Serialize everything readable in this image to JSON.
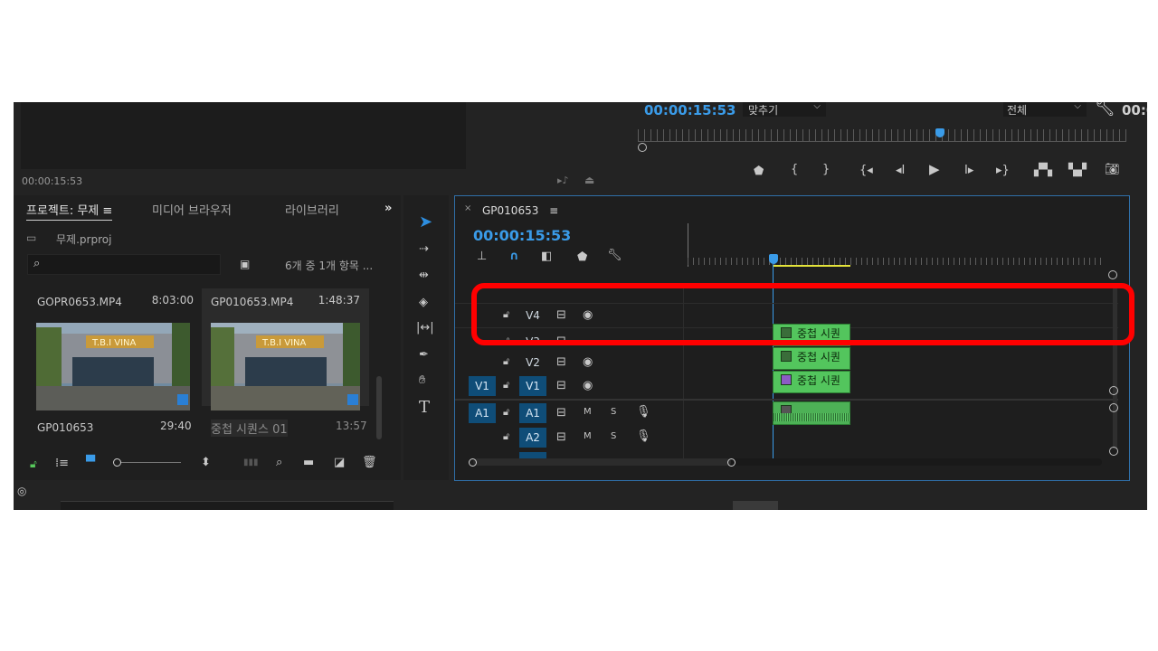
{
  "source_monitor": {
    "timecode": "00:00:15:53"
  },
  "program_monitor": {
    "timecode": "00:00:15:53",
    "fit_label": "맞추기",
    "quality_label": "전체",
    "right_timecode": "00:0"
  },
  "project_panel": {
    "tabs": [
      "프로젝트: 무제",
      "미디어 브라우저",
      "라이브러리"
    ],
    "project_file": "무제.prproj",
    "search_placeholder": "",
    "item_count": "6개 중 1개 항목 ...",
    "items": [
      {
        "name": "GOPR0653.MP4",
        "duration": "8:03:00"
      },
      {
        "name": "GP010653.MP4",
        "duration": "1:48:37"
      },
      {
        "name": "GP010653",
        "duration": "29:40"
      },
      {
        "name": "중첩 시퀀스 01",
        "duration": "13:57"
      }
    ],
    "thumb_sign": "T.B.I VINA"
  },
  "timeline": {
    "sequence_name": "GP010653",
    "timecode": "00:00:15:53",
    "tracks": [
      {
        "source": "",
        "name": "V4"
      },
      {
        "source": "",
        "name": "V3"
      },
      {
        "source": "",
        "name": "V2"
      },
      {
        "source": "V1",
        "name": "V1"
      },
      {
        "source": "A1",
        "name": "A1",
        "m": "M",
        "s": "S"
      },
      {
        "source": "",
        "name": "A2",
        "m": "M",
        "s": "S"
      }
    ],
    "clip_label": "중첩 시퀀"
  },
  "annotation": {
    "color": "#ff0000"
  },
  "colors": {
    "accent": "#3a9be8",
    "clip": "#53c55d",
    "panel": "#1e1e1e",
    "track_on": "#0f4d78"
  }
}
